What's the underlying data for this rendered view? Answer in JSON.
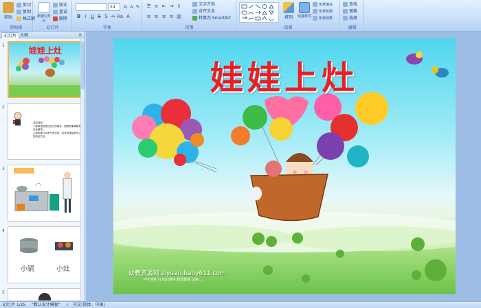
{
  "ribbon": {
    "clipboard": {
      "label": "剪贴板",
      "paste": "粘贴",
      "cut": "剪切",
      "copy": "复制",
      "format_painter": "格式刷"
    },
    "slides": {
      "label": "幻灯片",
      "new_slide": "新建幻灯片",
      "layout": "版式",
      "reset": "重设",
      "delete": "删除"
    },
    "font": {
      "label": "字体",
      "font_size": "24"
    },
    "paragraph": {
      "label": "段落",
      "text_direction": "文字方向",
      "align_text": "对齐文本",
      "smartart": "转换为 SmartArt"
    },
    "drawing": {
      "label": "绘图",
      "arrange": "排列",
      "quick_styles": "快速样式",
      "shape_fill": "形状填充",
      "shape_outline": "形状轮廓",
      "shape_effects": "形状效果"
    },
    "editing": {
      "label": "编辑",
      "find": "查找",
      "replace": "替换",
      "select": "选择"
    }
  },
  "left_panel": {
    "tab_slides": "幻灯片",
    "tab_outline": "大纲",
    "close": "×",
    "thumbnails": [
      {
        "number": "1",
        "title": "娃娃上灶"
      },
      {
        "number": "2",
        "lines": [
          "活动目标：",
          "1.能用语言表达自己的看法，感受到事事都有办法解决。",
          "2.能知道什么是不安全的，初步知道保护自己的安全方法。"
        ]
      },
      {
        "number": "3"
      },
      {
        "number": "4",
        "labels": [
          "小锅",
          "小灶"
        ]
      },
      {
        "number": "5"
      }
    ]
  },
  "slide": {
    "title": "娃娃上灶",
    "watermark": "幼教资源网 ziyuan.baby611.com",
    "watermark_sub": "PPT课件 FLASH课件 教案教程 试卷……"
  },
  "status_bar": {
    "slide_info": "幻灯片 1/25",
    "theme": "\"默认设计模板\"",
    "language": "中文(简体，中国)"
  },
  "colors": {
    "title_red": "#ea1e25",
    "sky_top": "#4fd6ee",
    "grass": "#6cc24a",
    "ribbon_bg": "#c4dcf7",
    "selected_thumb_border": "#f5b34a"
  }
}
